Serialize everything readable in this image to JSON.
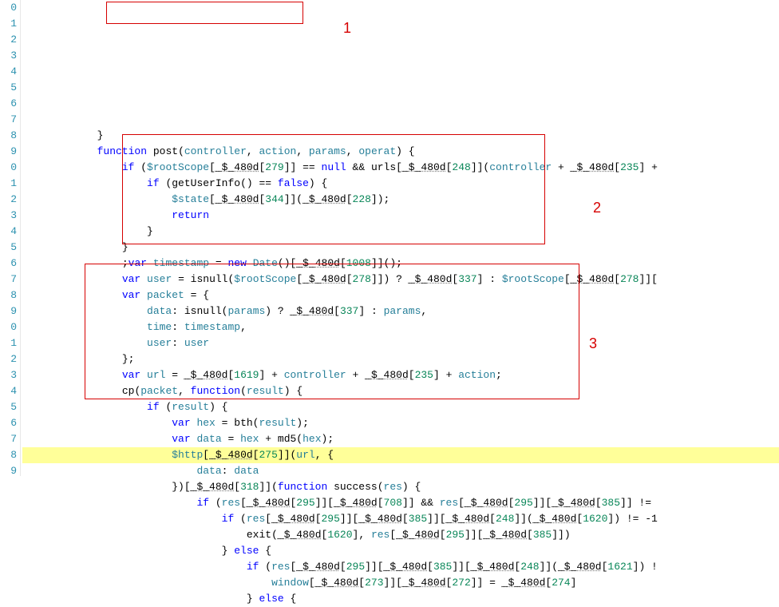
{
  "annotations": {
    "box1_label": "1",
    "box2_label": "2",
    "box3_label": "3"
  },
  "gutter_digits": [
    "0",
    "1",
    "2",
    "3",
    "4",
    "5",
    "6",
    "7",
    "8",
    "9",
    "0",
    "1",
    "2",
    "3",
    "4",
    "5",
    "6",
    "7",
    "8",
    "9",
    "0",
    "1",
    "2",
    "3",
    "4",
    "5",
    "6",
    "7",
    "8",
    "9"
  ],
  "code_lines": [
    {
      "indent": 12,
      "tokens": [
        {
          "t": "}",
          "c": "pun"
        }
      ]
    },
    {
      "indent": 12,
      "tokens": [
        {
          "t": "function ",
          "c": "kw"
        },
        {
          "t": "post",
          "c": "fn"
        },
        {
          "t": "(",
          "c": "pun"
        },
        {
          "t": "controller",
          "c": "var"
        },
        {
          "t": ", ",
          "c": "pun"
        },
        {
          "t": "action",
          "c": "var"
        },
        {
          "t": ", ",
          "c": "pun"
        },
        {
          "t": "params",
          "c": "var"
        },
        {
          "t": ", ",
          "c": "pun"
        },
        {
          "t": "operat",
          "c": "var"
        },
        {
          "t": ") {",
          "c": "pun"
        }
      ]
    },
    {
      "indent": 16,
      "tokens": [
        {
          "t": "if ",
          "c": "kw"
        },
        {
          "t": "(",
          "c": "pun"
        },
        {
          "t": "$rootScope",
          "c": "glb"
        },
        {
          "t": "[",
          "c": "pun"
        },
        {
          "t": "_$_480d",
          "c": "id ud"
        },
        {
          "t": "[",
          "c": "pun"
        },
        {
          "t": "279",
          "c": "num"
        },
        {
          "t": "]] == ",
          "c": "pun"
        },
        {
          "t": "null",
          "c": "kw"
        },
        {
          "t": " && ",
          "c": "op"
        },
        {
          "t": "urls",
          "c": "id"
        },
        {
          "t": "[",
          "c": "pun"
        },
        {
          "t": "_$_480d",
          "c": "id ud"
        },
        {
          "t": "[",
          "c": "pun"
        },
        {
          "t": "248",
          "c": "num"
        },
        {
          "t": "]](",
          "c": "pun"
        },
        {
          "t": "controller",
          "c": "var"
        },
        {
          "t": " + ",
          "c": "op"
        },
        {
          "t": "_$_480d",
          "c": "id ud"
        },
        {
          "t": "[",
          "c": "pun"
        },
        {
          "t": "235",
          "c": "num"
        },
        {
          "t": "] +",
          "c": "pun"
        }
      ]
    },
    {
      "indent": 20,
      "tokens": [
        {
          "t": "if ",
          "c": "kw"
        },
        {
          "t": "(",
          "c": "pun"
        },
        {
          "t": "getUserInfo",
          "c": "fn"
        },
        {
          "t": "() == ",
          "c": "pun"
        },
        {
          "t": "false",
          "c": "kw"
        },
        {
          "t": ") {",
          "c": "pun"
        }
      ]
    },
    {
      "indent": 24,
      "tokens": [
        {
          "t": "$state",
          "c": "glb"
        },
        {
          "t": "[",
          "c": "pun"
        },
        {
          "t": "_$_480d",
          "c": "id ud"
        },
        {
          "t": "[",
          "c": "pun"
        },
        {
          "t": "344",
          "c": "num"
        },
        {
          "t": "]](",
          "c": "pun"
        },
        {
          "t": "_$_480d",
          "c": "id ud"
        },
        {
          "t": "[",
          "c": "pun"
        },
        {
          "t": "228",
          "c": "num"
        },
        {
          "t": "]);",
          "c": "pun"
        }
      ]
    },
    {
      "indent": 24,
      "tokens": [
        {
          "t": "return",
          "c": "kw"
        }
      ]
    },
    {
      "indent": 20,
      "tokens": [
        {
          "t": "}",
          "c": "pun"
        }
      ]
    },
    {
      "indent": 16,
      "tokens": [
        {
          "t": "}",
          "c": "pun"
        }
      ]
    },
    {
      "indent": 16,
      "tokens": [
        {
          "t": ";",
          "c": "pun"
        },
        {
          "t": "var ",
          "c": "kw"
        },
        {
          "t": "timestamp",
          "c": "var"
        },
        {
          "t": " = ",
          "c": "op"
        },
        {
          "t": "new ",
          "c": "kw"
        },
        {
          "t": "Date",
          "c": "glb"
        },
        {
          "t": "()[",
          "c": "pun"
        },
        {
          "t": "_$_480d",
          "c": "id ud"
        },
        {
          "t": "[",
          "c": "pun"
        },
        {
          "t": "1008",
          "c": "num"
        },
        {
          "t": "]]();",
          "c": "pun"
        }
      ]
    },
    {
      "indent": 16,
      "tokens": [
        {
          "t": "var ",
          "c": "kw"
        },
        {
          "t": "user",
          "c": "var"
        },
        {
          "t": " = ",
          "c": "op"
        },
        {
          "t": "isnull",
          "c": "fn"
        },
        {
          "t": "(",
          "c": "pun"
        },
        {
          "t": "$rootScope",
          "c": "glb"
        },
        {
          "t": "[",
          "c": "pun"
        },
        {
          "t": "_$_480d",
          "c": "id ud"
        },
        {
          "t": "[",
          "c": "pun"
        },
        {
          "t": "278",
          "c": "num"
        },
        {
          "t": "]]) ? ",
          "c": "pun"
        },
        {
          "t": "_$_480d",
          "c": "id ud"
        },
        {
          "t": "[",
          "c": "pun"
        },
        {
          "t": "337",
          "c": "num"
        },
        {
          "t": "] : ",
          "c": "pun"
        },
        {
          "t": "$rootScope",
          "c": "glb"
        },
        {
          "t": "[",
          "c": "pun"
        },
        {
          "t": "_$_480d",
          "c": "id ud"
        },
        {
          "t": "[",
          "c": "pun"
        },
        {
          "t": "278",
          "c": "num"
        },
        {
          "t": "]][",
          "c": "pun"
        }
      ]
    },
    {
      "indent": 16,
      "tokens": [
        {
          "t": "var ",
          "c": "kw"
        },
        {
          "t": "packet",
          "c": "var"
        },
        {
          "t": " = {",
          "c": "pun"
        }
      ]
    },
    {
      "indent": 20,
      "tokens": [
        {
          "t": "data",
          "c": "var"
        },
        {
          "t": ": ",
          "c": "pun"
        },
        {
          "t": "isnull",
          "c": "fn"
        },
        {
          "t": "(",
          "c": "pun"
        },
        {
          "t": "params",
          "c": "var"
        },
        {
          "t": ") ? ",
          "c": "pun"
        },
        {
          "t": "_$_480d",
          "c": "id ud"
        },
        {
          "t": "[",
          "c": "pun"
        },
        {
          "t": "337",
          "c": "num"
        },
        {
          "t": "] : ",
          "c": "pun"
        },
        {
          "t": "params",
          "c": "var"
        },
        {
          "t": ",",
          "c": "pun"
        }
      ]
    },
    {
      "indent": 20,
      "tokens": [
        {
          "t": "time",
          "c": "var"
        },
        {
          "t": ": ",
          "c": "pun"
        },
        {
          "t": "timestamp",
          "c": "var"
        },
        {
          "t": ",",
          "c": "pun"
        }
      ]
    },
    {
      "indent": 20,
      "tokens": [
        {
          "t": "user",
          "c": "var"
        },
        {
          "t": ": ",
          "c": "pun"
        },
        {
          "t": "user",
          "c": "var"
        }
      ]
    },
    {
      "indent": 16,
      "tokens": [
        {
          "t": "};",
          "c": "pun"
        }
      ]
    },
    {
      "indent": 16,
      "tokens": [
        {
          "t": "var ",
          "c": "kw"
        },
        {
          "t": "url",
          "c": "var"
        },
        {
          "t": " = ",
          "c": "op"
        },
        {
          "t": "_$_480d",
          "c": "id ud"
        },
        {
          "t": "[",
          "c": "pun"
        },
        {
          "t": "1619",
          "c": "num"
        },
        {
          "t": "] + ",
          "c": "pun"
        },
        {
          "t": "controller",
          "c": "var"
        },
        {
          "t": " + ",
          "c": "op"
        },
        {
          "t": "_$_480d",
          "c": "id ud"
        },
        {
          "t": "[",
          "c": "pun"
        },
        {
          "t": "235",
          "c": "num"
        },
        {
          "t": "] + ",
          "c": "pun"
        },
        {
          "t": "action",
          "c": "var"
        },
        {
          "t": ";",
          "c": "pun"
        }
      ]
    },
    {
      "indent": 16,
      "tokens": [
        {
          "t": "cp",
          "c": "fn"
        },
        {
          "t": "(",
          "c": "pun"
        },
        {
          "t": "packet",
          "c": "var"
        },
        {
          "t": ", ",
          "c": "pun"
        },
        {
          "t": "function",
          "c": "kw"
        },
        {
          "t": "(",
          "c": "pun"
        },
        {
          "t": "result",
          "c": "var"
        },
        {
          "t": ") {",
          "c": "pun"
        }
      ]
    },
    {
      "indent": 20,
      "tokens": [
        {
          "t": "if ",
          "c": "kw"
        },
        {
          "t": "(",
          "c": "pun"
        },
        {
          "t": "result",
          "c": "var"
        },
        {
          "t": ") {",
          "c": "pun"
        }
      ]
    },
    {
      "indent": 24,
      "tokens": [
        {
          "t": "var ",
          "c": "kw"
        },
        {
          "t": "hex",
          "c": "var"
        },
        {
          "t": " = ",
          "c": "op"
        },
        {
          "t": "bth",
          "c": "fn"
        },
        {
          "t": "(",
          "c": "pun"
        },
        {
          "t": "result",
          "c": "var"
        },
        {
          "t": ");",
          "c": "pun"
        }
      ]
    },
    {
      "indent": 24,
      "tokens": [
        {
          "t": "var ",
          "c": "kw"
        },
        {
          "t": "data",
          "c": "var"
        },
        {
          "t": " = ",
          "c": "op"
        },
        {
          "t": "hex",
          "c": "var"
        },
        {
          "t": " + ",
          "c": "op"
        },
        {
          "t": "md5",
          "c": "fn"
        },
        {
          "t": "(",
          "c": "pun"
        },
        {
          "t": "hex",
          "c": "var"
        },
        {
          "t": ");",
          "c": "pun"
        }
      ]
    },
    {
      "indent": 24,
      "hl": true,
      "tokens": [
        {
          "t": "$http",
          "c": "glb"
        },
        {
          "t": "[",
          "c": "pun"
        },
        {
          "t": "_$_480d",
          "c": "id ud"
        },
        {
          "t": "[",
          "c": "pun"
        },
        {
          "t": "275",
          "c": "num"
        },
        {
          "t": "]](",
          "c": "pun"
        },
        {
          "t": "url",
          "c": "var"
        },
        {
          "t": ", {",
          "c": "pun"
        }
      ]
    },
    {
      "indent": 28,
      "tokens": [
        {
          "t": "data",
          "c": "var"
        },
        {
          "t": ": ",
          "c": "pun"
        },
        {
          "t": "data",
          "c": "var"
        }
      ]
    },
    {
      "indent": 24,
      "tokens": [
        {
          "t": "})[",
          "c": "pun"
        },
        {
          "t": "_$_480d",
          "c": "id ud"
        },
        {
          "t": "[",
          "c": "pun"
        },
        {
          "t": "318",
          "c": "num"
        },
        {
          "t": "]](",
          "c": "pun"
        },
        {
          "t": "function ",
          "c": "kw"
        },
        {
          "t": "success",
          "c": "fn"
        },
        {
          "t": "(",
          "c": "pun"
        },
        {
          "t": "res",
          "c": "var"
        },
        {
          "t": ") {",
          "c": "pun"
        }
      ]
    },
    {
      "indent": 28,
      "tokens": [
        {
          "t": "if ",
          "c": "kw"
        },
        {
          "t": "(",
          "c": "pun"
        },
        {
          "t": "res",
          "c": "var"
        },
        {
          "t": "[",
          "c": "pun"
        },
        {
          "t": "_$_480d",
          "c": "id ud"
        },
        {
          "t": "[",
          "c": "pun"
        },
        {
          "t": "295",
          "c": "num"
        },
        {
          "t": "]][",
          "c": "pun"
        },
        {
          "t": "_$_480d",
          "c": "id ud"
        },
        {
          "t": "[",
          "c": "pun"
        },
        {
          "t": "708",
          "c": "num"
        },
        {
          "t": "]] && ",
          "c": "pun"
        },
        {
          "t": "res",
          "c": "var"
        },
        {
          "t": "[",
          "c": "pun"
        },
        {
          "t": "_$_480d",
          "c": "id ud"
        },
        {
          "t": "[",
          "c": "pun"
        },
        {
          "t": "295",
          "c": "num"
        },
        {
          "t": "]][",
          "c": "pun"
        },
        {
          "t": "_$_480d",
          "c": "id ud"
        },
        {
          "t": "[",
          "c": "pun"
        },
        {
          "t": "385",
          "c": "num"
        },
        {
          "t": "]] !=",
          "c": "pun"
        }
      ]
    },
    {
      "indent": 32,
      "tokens": [
        {
          "t": "if ",
          "c": "kw"
        },
        {
          "t": "(",
          "c": "pun"
        },
        {
          "t": "res",
          "c": "var"
        },
        {
          "t": "[",
          "c": "pun"
        },
        {
          "t": "_$_480d",
          "c": "id ud"
        },
        {
          "t": "[",
          "c": "pun"
        },
        {
          "t": "295",
          "c": "num"
        },
        {
          "t": "]][",
          "c": "pun"
        },
        {
          "t": "_$_480d",
          "c": "id ud"
        },
        {
          "t": "[",
          "c": "pun"
        },
        {
          "t": "385",
          "c": "num"
        },
        {
          "t": "]][",
          "c": "pun"
        },
        {
          "t": "_$_480d",
          "c": "id ud"
        },
        {
          "t": "[",
          "c": "pun"
        },
        {
          "t": "248",
          "c": "num"
        },
        {
          "t": "]](",
          "c": "pun"
        },
        {
          "t": "_$_480d",
          "c": "id ud"
        },
        {
          "t": "[",
          "c": "pun"
        },
        {
          "t": "1620",
          "c": "num"
        },
        {
          "t": "]) != -1",
          "c": "pun"
        }
      ]
    },
    {
      "indent": 36,
      "tokens": [
        {
          "t": "exit",
          "c": "fn"
        },
        {
          "t": "(",
          "c": "pun"
        },
        {
          "t": "_$_480d",
          "c": "id ud"
        },
        {
          "t": "[",
          "c": "pun"
        },
        {
          "t": "1620",
          "c": "num"
        },
        {
          "t": "], ",
          "c": "pun"
        },
        {
          "t": "res",
          "c": "var"
        },
        {
          "t": "[",
          "c": "pun"
        },
        {
          "t": "_$_480d",
          "c": "id ud"
        },
        {
          "t": "[",
          "c": "pun"
        },
        {
          "t": "295",
          "c": "num"
        },
        {
          "t": "]][",
          "c": "pun"
        },
        {
          "t": "_$_480d",
          "c": "id ud"
        },
        {
          "t": "[",
          "c": "pun"
        },
        {
          "t": "385",
          "c": "num"
        },
        {
          "t": "]])",
          "c": "pun"
        }
      ]
    },
    {
      "indent": 32,
      "tokens": [
        {
          "t": "} ",
          "c": "pun"
        },
        {
          "t": "else",
          "c": "kw"
        },
        {
          "t": " {",
          "c": "pun"
        }
      ]
    },
    {
      "indent": 36,
      "tokens": [
        {
          "t": "if ",
          "c": "kw"
        },
        {
          "t": "(",
          "c": "pun"
        },
        {
          "t": "res",
          "c": "var"
        },
        {
          "t": "[",
          "c": "pun"
        },
        {
          "t": "_$_480d",
          "c": "id ud"
        },
        {
          "t": "[",
          "c": "pun"
        },
        {
          "t": "295",
          "c": "num"
        },
        {
          "t": "]][",
          "c": "pun"
        },
        {
          "t": "_$_480d",
          "c": "id ud"
        },
        {
          "t": "[",
          "c": "pun"
        },
        {
          "t": "385",
          "c": "num"
        },
        {
          "t": "]][",
          "c": "pun"
        },
        {
          "t": "_$_480d",
          "c": "id ud"
        },
        {
          "t": "[",
          "c": "pun"
        },
        {
          "t": "248",
          "c": "num"
        },
        {
          "t": "]](",
          "c": "pun"
        },
        {
          "t": "_$_480d",
          "c": "id ud"
        },
        {
          "t": "[",
          "c": "pun"
        },
        {
          "t": "1621",
          "c": "num"
        },
        {
          "t": "]) !",
          "c": "pun"
        }
      ]
    },
    {
      "indent": 40,
      "tokens": [
        {
          "t": "window",
          "c": "glb"
        },
        {
          "t": "[",
          "c": "pun"
        },
        {
          "t": "_$_480d",
          "c": "id ud"
        },
        {
          "t": "[",
          "c": "pun"
        },
        {
          "t": "273",
          "c": "num"
        },
        {
          "t": "]][",
          "c": "pun"
        },
        {
          "t": "_$_480d",
          "c": "id ud"
        },
        {
          "t": "[",
          "c": "pun"
        },
        {
          "t": "272",
          "c": "num"
        },
        {
          "t": "]] = ",
          "c": "pun"
        },
        {
          "t": "_$_480d",
          "c": "id ud"
        },
        {
          "t": "[",
          "c": "pun"
        },
        {
          "t": "274",
          "c": "num"
        },
        {
          "t": "]",
          "c": "pun"
        }
      ]
    },
    {
      "indent": 36,
      "tokens": [
        {
          "t": "} ",
          "c": "pun"
        },
        {
          "t": "else",
          "c": "kw"
        },
        {
          "t": " {",
          "c": "pun"
        }
      ]
    }
  ]
}
